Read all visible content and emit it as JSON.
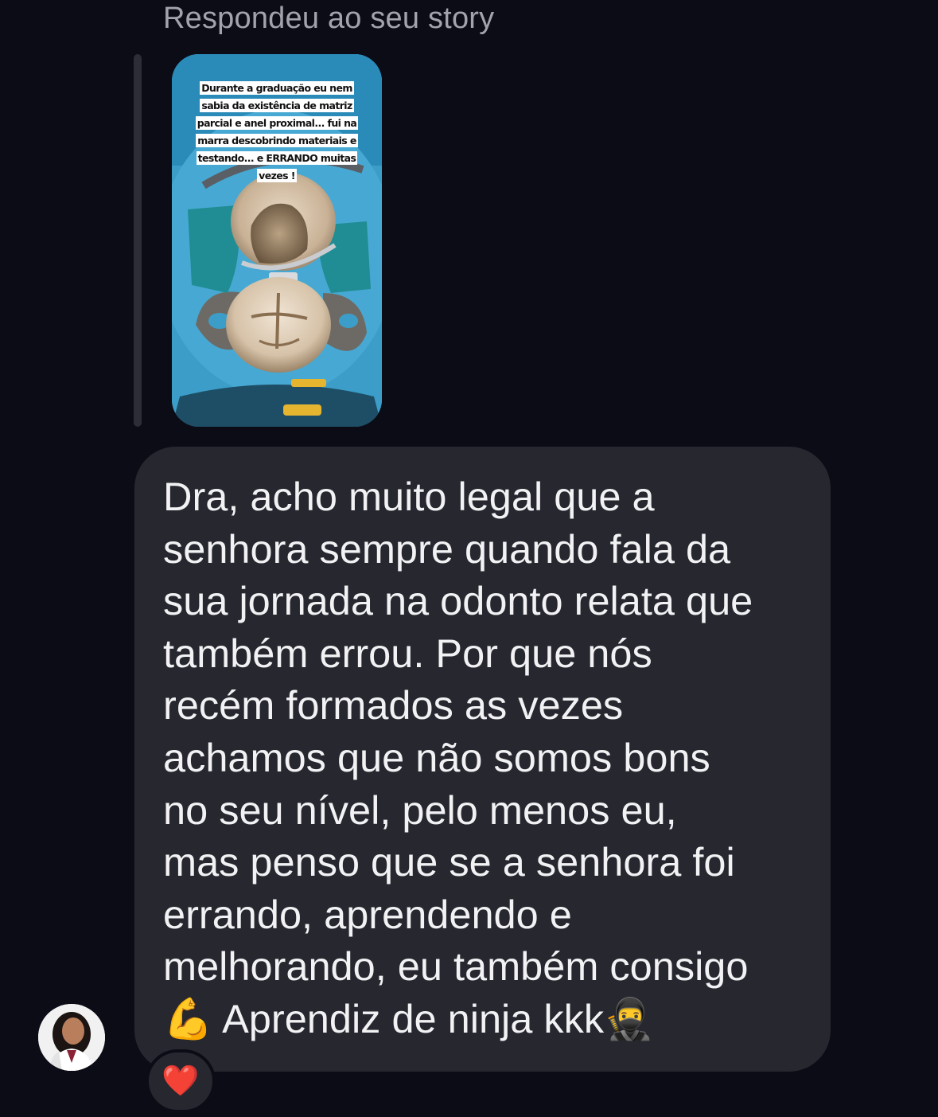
{
  "reply_header": "Respondeu ao seu story",
  "story": {
    "caption": "Durante a graduação eu nem sabia da existência de matriz parcial e anel proximal... fui na marra descobrindo materiais e testando... e ERRANDO muitas vezes !"
  },
  "message": {
    "text": "Dra, acho muito legal que a\nsenhora sempre quando fala da\nsua jornada na odonto relata que\ntambém errou. Por que nós\nrecém formados as vezes\nachamos que não somos bons\nno seu nível, pelo menos eu,\nmas penso que se a senhora foi\nerrando, aprendendo e\nmelhorando, eu também consigo\n💪 Aprendiz de ninja kkk🥷"
  },
  "reaction": {
    "emoji": "❤️"
  },
  "colors": {
    "background": "#0b0c16",
    "bubble": "#26272f",
    "header_text": "#a2a3ad",
    "message_text": "#f2f2f4",
    "rubber_dam": "#3fa3cc"
  },
  "icons": {
    "avatar": "user-avatar-photo",
    "reaction": "heart-icon"
  }
}
